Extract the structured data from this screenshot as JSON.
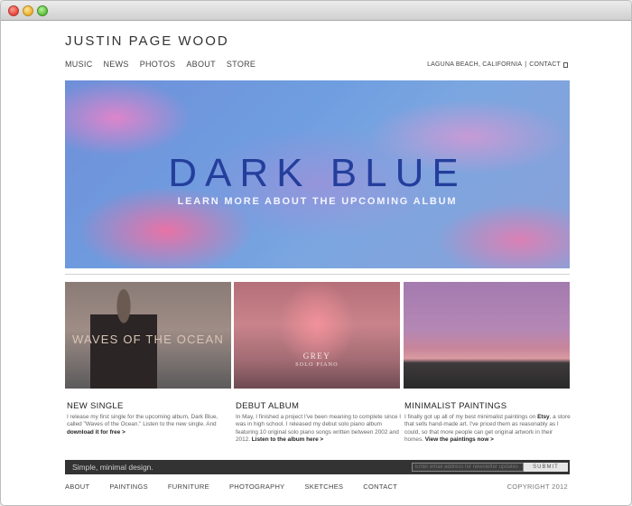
{
  "site": {
    "title": "JUSTIN PAGE WOOD",
    "nav": [
      "MUSIC",
      "NEWS",
      "PHOTOS",
      "ABOUT",
      "STORE"
    ],
    "location": "LAGUNA BEACH, CALIFORNIA",
    "separator": "|",
    "contact": "CONTACT"
  },
  "hero": {
    "title": "DARK BLUE",
    "subtitle": "LEARN MORE ABOUT THE UPCOMING ALBUM"
  },
  "thumbs": {
    "t1_label": "WAVES OF THE OCEAN",
    "t2_label1": "GREY",
    "t2_label2": "SOLO PIANO"
  },
  "columns": [
    {
      "heading": "NEW SINGLE",
      "text": "I release my first single for the upcoming album, Dark Blue, called \"Waves of the Ocean.\" Listen to the new single. And",
      "link": "download it for free >"
    },
    {
      "heading": "DEBUT ALBUM",
      "text": "In May, I finished a project I've been meaning to complete since I was in high school. I released my debut solo piano album featuring 10 original solo piano songs written between 2002 and 2012.",
      "link": "Listen to the album here >"
    },
    {
      "heading": "MINIMALIST PAINTINGS",
      "text_before": "I finally got up all of my best minimalist paintings on",
      "etsy": "Etsy",
      "text_after": ", a store that sells hand-made art. I've priced them as reasonably as I could, so that more people can get original artwork in their homes.",
      "link": "View the paintings now >"
    }
  ],
  "newsletter": {
    "tagline": "Simple, minimal design.",
    "placeholder": "Enter email address for newsletter updates",
    "submit": "SUBMIT"
  },
  "footer": {
    "nav": [
      "ABOUT",
      "PAINTINGS",
      "FURNITURE",
      "PHOTOGRAPHY",
      "SKETCHES",
      "CONTACT"
    ],
    "copyright": "COPYRIGHT 2012"
  }
}
